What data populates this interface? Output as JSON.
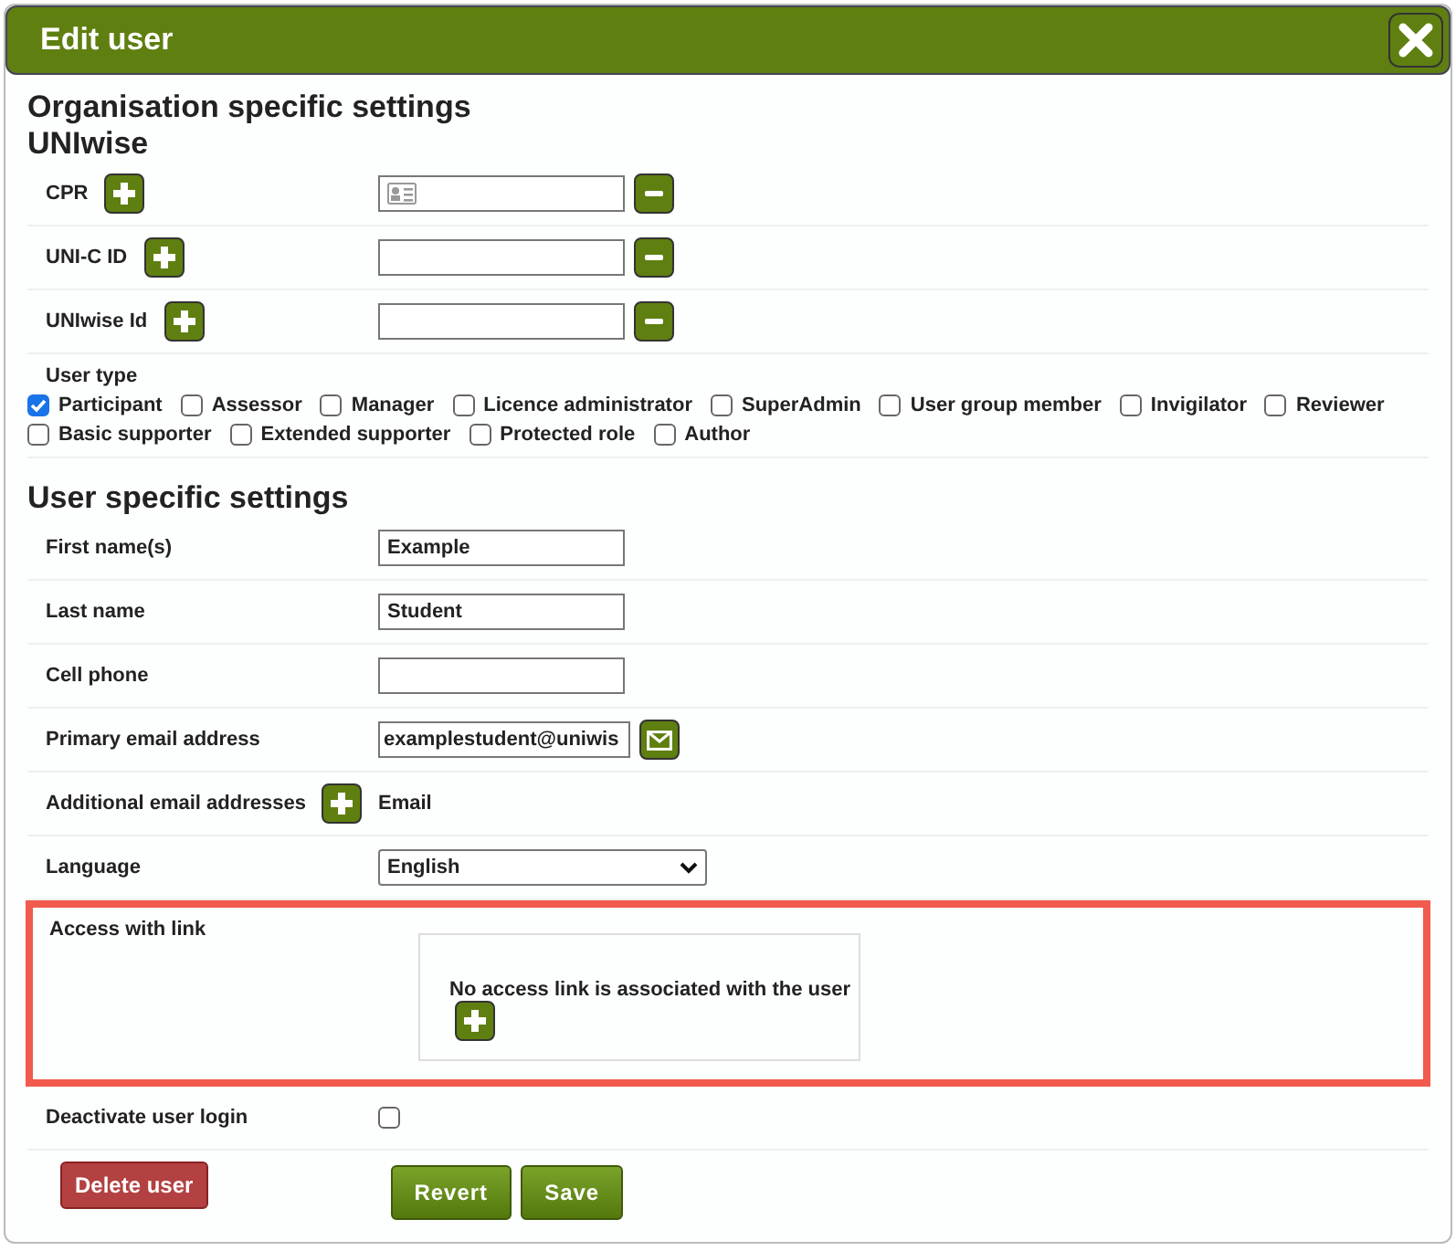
{
  "window": {
    "title": "Edit user"
  },
  "organisation": {
    "heading": "Organisation specific settings",
    "subheading": "UNIwise",
    "id_fields": [
      {
        "label": "CPR",
        "kind": "card"
      },
      {
        "label": "UNI-C ID",
        "kind": "plain"
      },
      {
        "label": "UNIwise Id",
        "kind": "plain"
      }
    ],
    "user_type": {
      "label": "User type",
      "options": [
        {
          "label": "Participant",
          "checked": true
        },
        {
          "label": "Assessor",
          "checked": false
        },
        {
          "label": "Manager",
          "checked": false
        },
        {
          "label": "Licence administrator",
          "checked": false
        },
        {
          "label": "SuperAdmin",
          "checked": false
        },
        {
          "label": "User group member",
          "checked": false
        },
        {
          "label": "Invigilator",
          "checked": false
        },
        {
          "label": "Reviewer",
          "checked": false
        },
        {
          "label": "Basic supporter",
          "checked": false
        },
        {
          "label": "Extended supporter",
          "checked": false
        },
        {
          "label": "Protected role",
          "checked": false
        },
        {
          "label": "Author",
          "checked": false
        }
      ]
    }
  },
  "user": {
    "heading": "User specific settings",
    "fields": [
      {
        "kind": "text",
        "label": "First name(s)",
        "value": "Example"
      },
      {
        "kind": "text",
        "label": "Last name",
        "value": "Student"
      },
      {
        "kind": "text",
        "label": "Cell phone"
      },
      {
        "kind": "email",
        "label": "Primary email address",
        "value": "examplestudent@uniwis"
      },
      {
        "kind": "add",
        "label": "Additional email addresses",
        "text": "Email"
      },
      {
        "kind": "select",
        "label": "Language",
        "value": "English"
      },
      {
        "kind": "link",
        "label": "Access with link",
        "text": "No access link is associated with the user",
        "highlighted": true
      },
      {
        "kind": "checkbox",
        "label": "Deactivate user login",
        "checked": false
      }
    ]
  },
  "buttons": {
    "delete": "Delete user",
    "revert": "Revert",
    "save": "Save"
  }
}
